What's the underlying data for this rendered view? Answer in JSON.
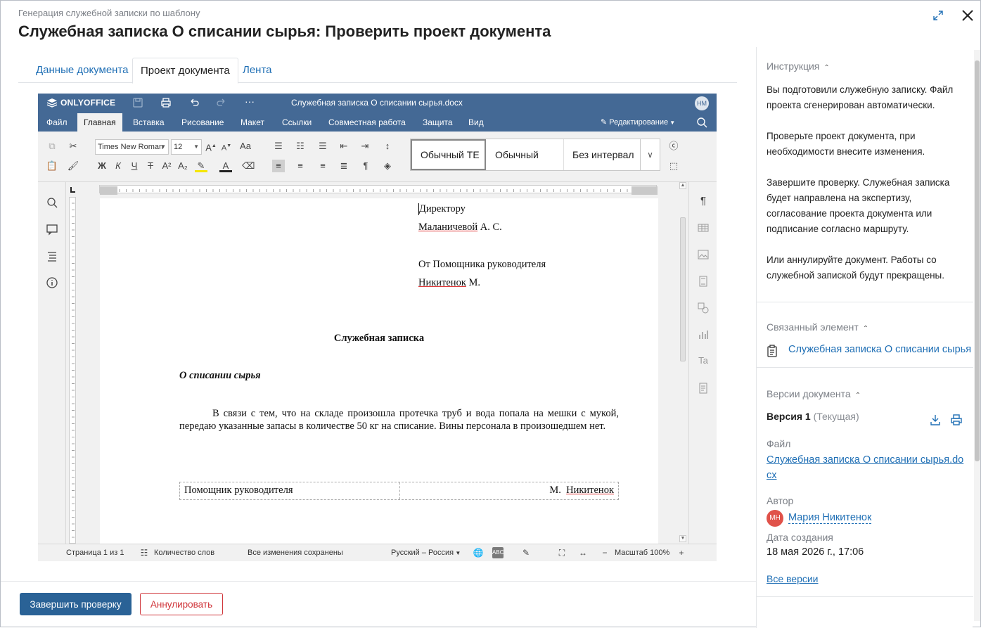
{
  "header": {
    "subtitle": "Генерация служебной записки по шаблону",
    "title": "Служебная записка   О списании сырья: Проверить проект документа"
  },
  "tabs": [
    {
      "label": "Данные документа"
    },
    {
      "label": "Проект документа",
      "active": true
    },
    {
      "label": "Лента"
    }
  ],
  "editor": {
    "brand": "ONLYOFFICE",
    "doc_title": "Служебная записка О списании сырья.docx",
    "avatar": "НМ",
    "menu": [
      "Файл",
      "Главная",
      "Вставка",
      "Рисование",
      "Макет",
      "Ссылки",
      "Совместная работа",
      "Защита",
      "Вид"
    ],
    "active_menu": "Главная",
    "mode": "Редактирование",
    "font_name": "Times New Roman",
    "font_size": "12",
    "styles": [
      "Обычный ТЕ",
      "Обычный",
      "Без интервал"
    ],
    "status": {
      "page": "Страница 1 из 1",
      "words": "Количество слов",
      "saved": "Все изменения сохранены",
      "language": "Русский – Россия",
      "zoom": "Масштаб 100%"
    }
  },
  "document": {
    "to_line1": "Директору",
    "to_name_ul": "Маланичевой",
    "to_name_rest": " А. С.",
    "from_line1": "От Помощника руководителя",
    "from_name_ul": "Никитенок",
    "from_name_rest": " М.",
    "heading": "Служебная записка",
    "subject": "О списании сырья",
    "body": "В связи с тем, что на складе произошла протечка труб и вода попала на мешки с мукой, передаю указанные запасы в количестве 50 кг на списание. Вины персонала в произошедшем нет.",
    "sig_role": "Помощник руководителя",
    "sig_initial": "М.  ",
    "sig_name": "Никитенок"
  },
  "panel": {
    "instruction_title": "Инструкция",
    "instruction_p1": "Вы подготовили служебную записку. Файл проекта сгенерирован автоматически.",
    "instruction_p2": "Проверьте проект документа, при необходимости внесите изменения.",
    "instruction_p3": "Завершите проверку. Служебная записка будет направлена на экспертизу, согласование проекта документа или подписание согласно маршруту.",
    "instruction_p4": "Или аннулируйте документ. Работы со служебной запиской будут прекращены.",
    "linked_title": "Связанный элемент",
    "linked_item": "Служебная записка О списании сырья",
    "versions_title": "Версии документа",
    "version_label": "Версия 1",
    "version_current": "(Текущая)",
    "file_label": "Файл",
    "file_name_1": "Служебная записка О списании сырья.do",
    "file_name_2": "cx",
    "author_label": "Автор",
    "author_initials": "МН",
    "author_name": "Мария Никитенок",
    "created_label": "Дата создания",
    "created_value": "18 мая 2026 г., 17:06",
    "all_versions": "Все версии"
  },
  "footer": {
    "finish": "Завершить проверку",
    "cancel": "Аннулировать"
  },
  "colors": {
    "editor_header": "#446995",
    "primary_button": "#2a6296",
    "danger": "#d0363b",
    "link": "#1f6fb5",
    "author_avatar": "#e0524a"
  }
}
